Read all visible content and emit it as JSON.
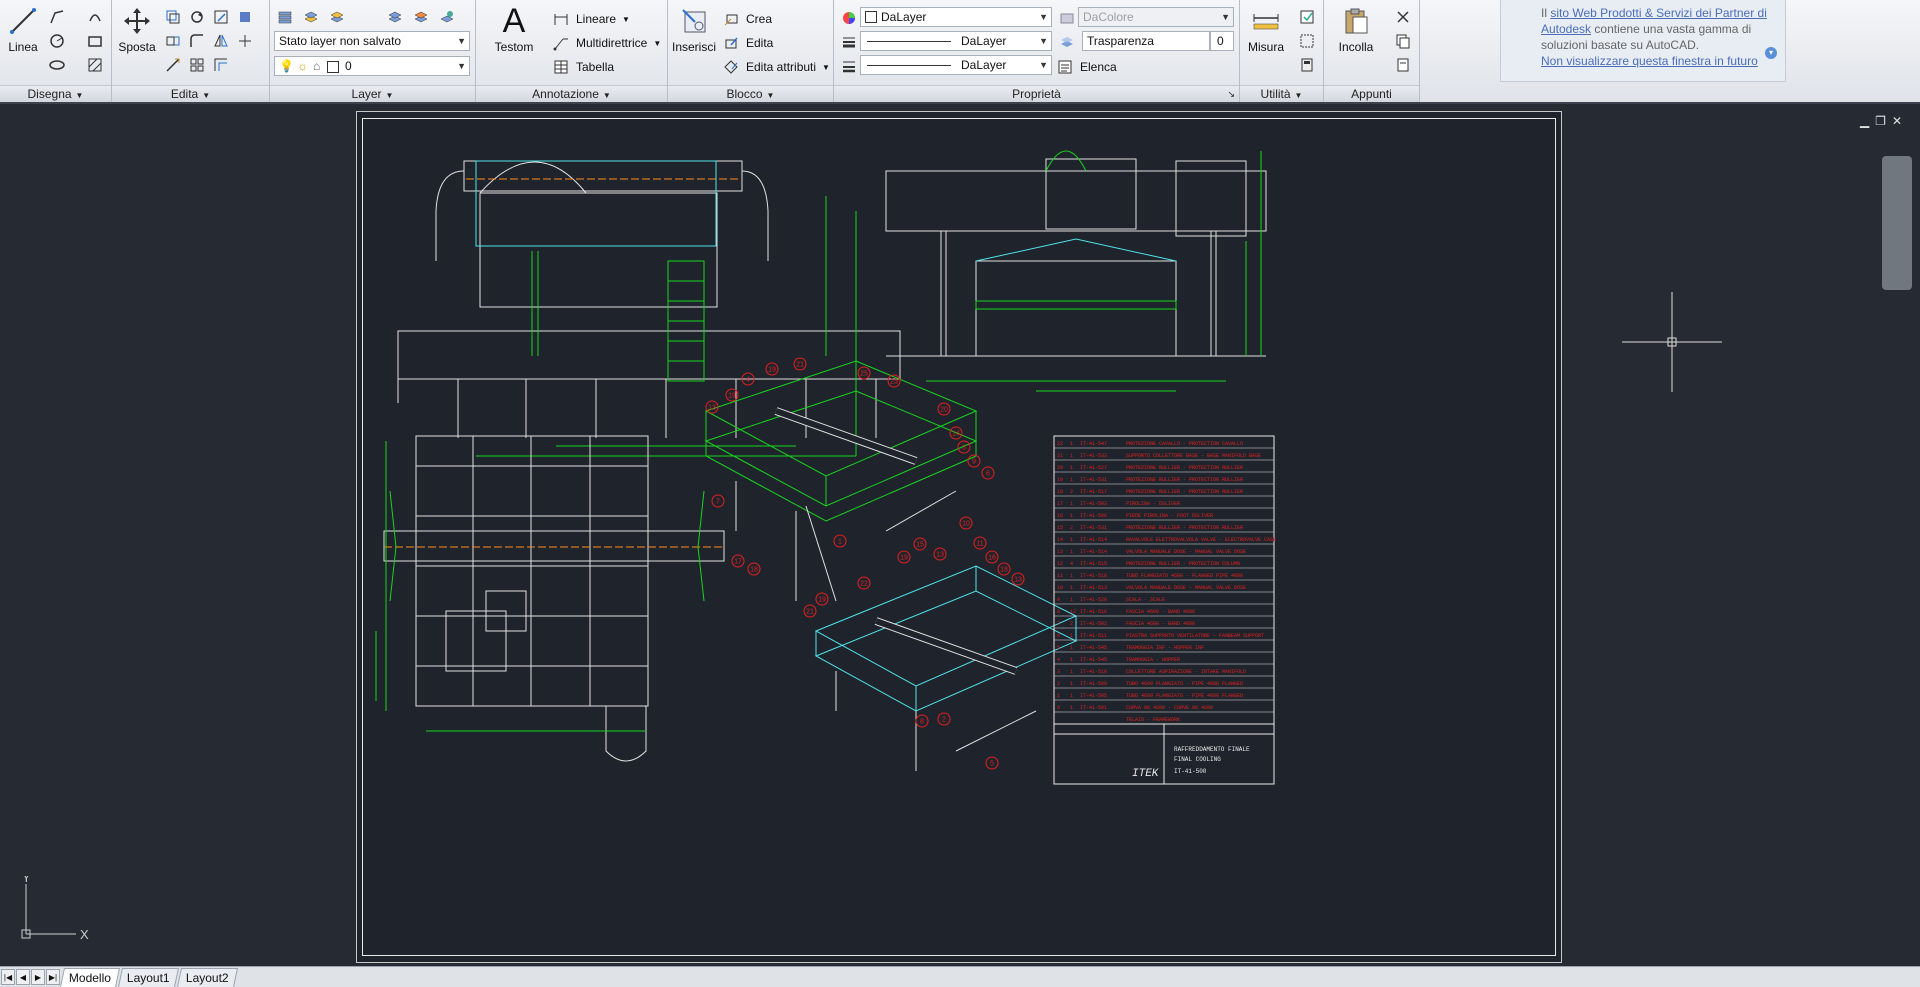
{
  "ribbon": {
    "disegna": {
      "title": "Disegna",
      "linea": "Linea"
    },
    "edita": {
      "title": "Edita",
      "sposta": "Sposta"
    },
    "layer": {
      "title": "Layer",
      "state": "Stato layer non salvato",
      "current": "0"
    },
    "annotazione": {
      "title": "Annotazione",
      "testom": "Testom",
      "lineare": "Lineare",
      "multidirettrice": "Multidirettrice",
      "tabella": "Tabella"
    },
    "blocco": {
      "title": "Blocco",
      "inserisci": "Inserisci",
      "crea": "Crea",
      "edita": "Edita",
      "edita_attributi": "Edita attributi"
    },
    "proprieta": {
      "title": "Proprietà",
      "color": "DaLayer",
      "color2": "DaColore",
      "linetype": "DaLayer",
      "lineweight": "DaLayer",
      "trasparenza": "Trasparenza",
      "trasp_value": "0",
      "elenca": "Elenca"
    },
    "utilita": {
      "title": "Utilità",
      "misura": "Misura"
    },
    "appunti": {
      "title": "Appunti",
      "incolla": "Incolla"
    }
  },
  "notification": {
    "pre": "Il",
    "link1": "sito Web Prodotti & Servizi dei Partner di Autodesk",
    "text": "contiene una vasta gamma di soluzioni basate su AutoCAD.",
    "link2": "Non visualizzare questa finestra in futuro"
  },
  "tabs": {
    "model": "Modello",
    "layout1": "Layout1",
    "layout2": "Layout2"
  },
  "ucs": {
    "x": "X",
    "y": "Y"
  },
  "title_block": {
    "title1": "RAFFREDDAMENTO FINALE",
    "title2": "FINAL COOLING",
    "logo": "ITEK",
    "number": "IT-41-500"
  },
  "bom": [
    [
      "22",
      "1",
      "IT-41-547",
      "PROTEZIONE CAVALLO - PROTECTION CAVALLO"
    ],
    [
      "21",
      "1",
      "IT-41-533",
      "SUPPORTO COLLETTORE BASE - BASE MANIFOLD BASE"
    ],
    [
      "20",
      "1",
      "IT-41-527",
      "PROTEZIONE RULLIER - PROTECTION RULLIER"
    ],
    [
      "19",
      "1",
      "IT-41-531",
      "PROTEZIONE RULLIER - PROTECTION RULLIER"
    ],
    [
      "18",
      "2",
      "IT-41-517",
      "PROTEZIONE RULLIER - PROTECTION RULLIER"
    ],
    [
      "17",
      "1",
      "IT-41-503",
      "PIROLINA - DSLIVER"
    ],
    [
      "16",
      "1",
      "IT-41-506",
      "PIEDE PIROLINA - FOOT DSLIVER"
    ],
    [
      "15",
      "2",
      "IT-41-531",
      "PROTEZIONE RULLIER - PROTECTION RULLIER"
    ],
    [
      "14",
      "1",
      "IT-41-514",
      "RAVALVOLE ELETTROVALVOLA VALVE - ELECTROVALVE CASE"
    ],
    [
      "13",
      "1",
      "IT-41-514",
      "VALVOLA MANUALE DOSE - MANUAL VALVE DOSE"
    ],
    [
      "12",
      "4",
      "IT-41-515",
      "PROTEZIONE RULLIER - PROTECTION COLUMN"
    ],
    [
      "11",
      "1",
      "IT-41-518",
      "TUBO FLANGIATO 4600 - FLANGED PIPE 4600"
    ],
    [
      "10",
      "1",
      "IT-41-513",
      "VALVOLA MANUALE DOSE - MANUAL VALVE DOSE"
    ],
    [
      "9",
      "1",
      "IT-41-520",
      "SCALA - SCALE"
    ],
    [
      "8",
      "12",
      "IT-41-516",
      "FASCIA 4600 - BAND 4600"
    ],
    [
      "7",
      "2",
      "IT-41-502",
      "FASCIA 4600 - BAND 4600"
    ],
    [
      "6",
      "1",
      "IT-41-511",
      "PIASTRA SUPPORTO VENTILATORE - FANBEAM SUPPORT"
    ],
    [
      "5",
      "1",
      "IT-41-545",
      "TRAMOGGIA INF - HOPPER INF"
    ],
    [
      "4",
      "1",
      "IT-41-545",
      "TRAMOGGIA - HOPPER"
    ],
    [
      "3",
      "1",
      "IT-41-510",
      "COLLETTORE ASPIRAZIONE - INTAKE MANIFOLD"
    ],
    [
      "2",
      "1",
      "IT-41-509",
      "TUBO 4600 FLANGIATO - PIPE 4600 FLANGED"
    ],
    [
      "1",
      "1",
      "IT-41-505",
      "TUBO 4600 FLANGIATO - PIPE 4600 FLANGED"
    ],
    [
      "0",
      "1",
      "IT-41-501",
      "CURVA 90 4600 - CURVE 90 4600"
    ],
    [
      "",
      "",
      "",
      "TELAIO - FRAMEWORK"
    ]
  ],
  "balloons": [
    "4",
    "19",
    "21",
    "25",
    "23",
    "13",
    "19",
    "20",
    "14",
    "3",
    "9",
    "6",
    "7",
    "17",
    "18",
    "1",
    "10",
    "11",
    "16",
    "18",
    "13",
    "19",
    "22",
    "15",
    "13",
    "19",
    "21",
    "8",
    "2",
    "5"
  ],
  "colors": {
    "green": "#19d41f",
    "cyan": "#4fe3e8",
    "white": "#e8e8e8",
    "red": "#e51f1f",
    "orange": "#ff8c1a",
    "bg": "#1f242c"
  }
}
